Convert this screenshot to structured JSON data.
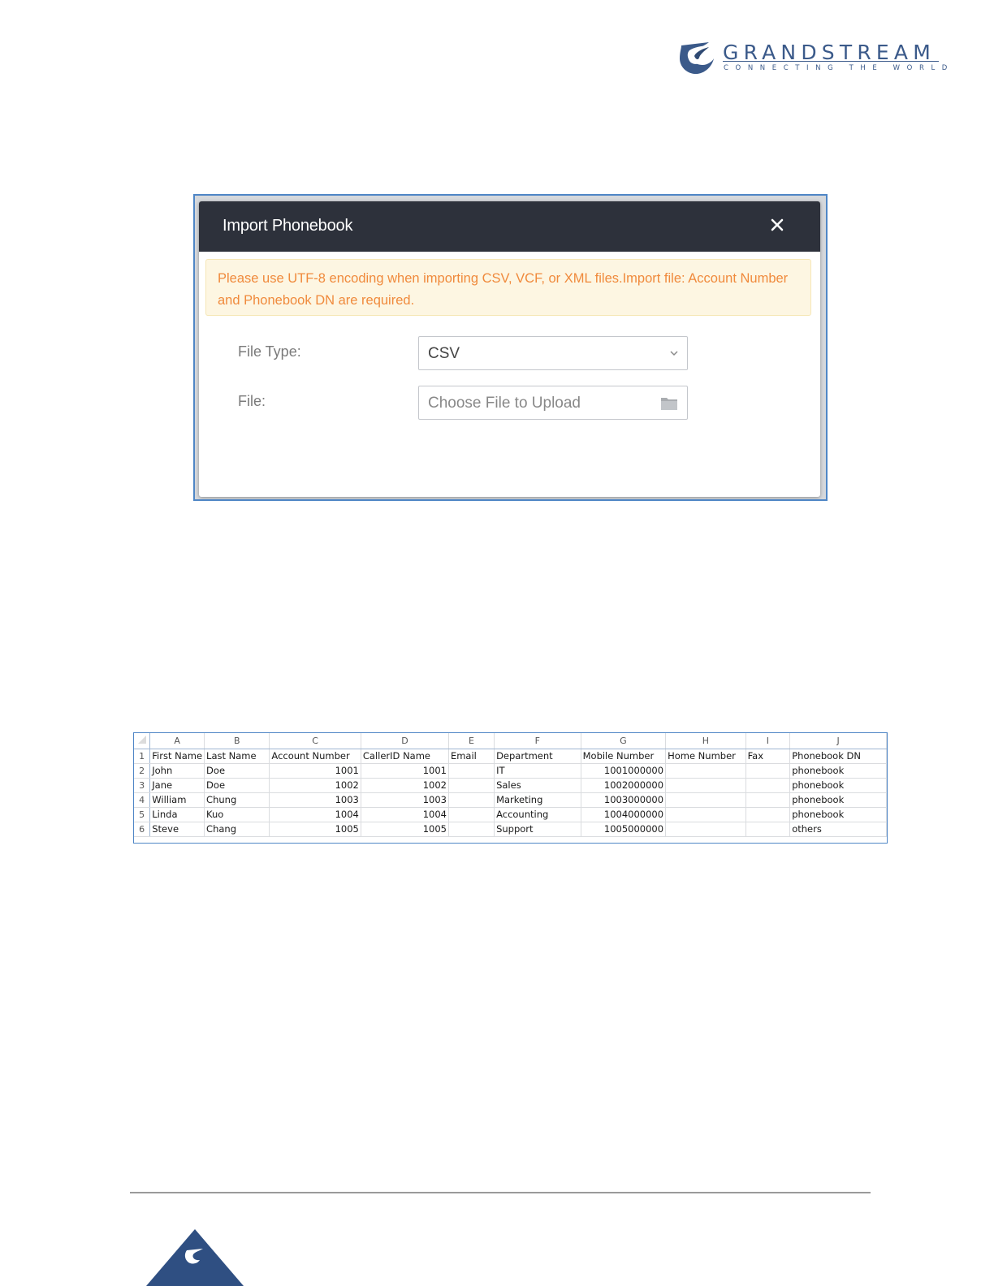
{
  "logo": {
    "wordmark": "GRANDSTREAM",
    "tagline": "CONNECTING THE WORLD",
    "brand_color": "#3b5a8a"
  },
  "dialog": {
    "title": "Import Phonebook",
    "close_icon": "close-icon",
    "notice": "Please use UTF-8 encoding when importing CSV, VCF, or XML files.Import file: Account Number and Phonebook DN are required.",
    "file_type_label": "File Type:",
    "file_type_value": "CSV",
    "file_label": "File:",
    "file_placeholder": "Choose File to Upload",
    "header_color": "#2d313b",
    "notice_text_color": "#f08a3c"
  },
  "spreadsheet": {
    "column_letters": [
      "A",
      "B",
      "C",
      "D",
      "E",
      "F",
      "G",
      "H",
      "I",
      "J"
    ],
    "header_row": {
      "num": "1",
      "cells": [
        "First Name",
        "Last Name",
        "Account Number",
        "CallerID Name",
        "Email",
        "Department",
        "Mobile Number",
        "Home Number",
        "Fax",
        "Phonebook DN"
      ]
    },
    "rows": [
      {
        "num": "2",
        "cells": [
          "John",
          "Doe",
          "1001",
          "1001",
          "",
          "IT",
          "1001000000",
          "",
          "",
          "phonebook"
        ]
      },
      {
        "num": "3",
        "cells": [
          "Jane",
          "Doe",
          "1002",
          "1002",
          "",
          "Sales",
          "1002000000",
          "",
          "",
          "phonebook"
        ]
      },
      {
        "num": "4",
        "cells": [
          "William",
          "Chung",
          "1003",
          "1003",
          "",
          "Marketing",
          "1003000000",
          "",
          "",
          "phonebook"
        ]
      },
      {
        "num": "5",
        "cells": [
          "Linda",
          "Kuo",
          "1004",
          "1004",
          "",
          "Accounting",
          "1004000000",
          "",
          "",
          "phonebook"
        ]
      },
      {
        "num": "6",
        "cells": [
          "Steve",
          "Chang",
          "1005",
          "1005",
          "",
          "Support",
          "1005000000",
          "",
          "",
          "others"
        ]
      }
    ]
  }
}
